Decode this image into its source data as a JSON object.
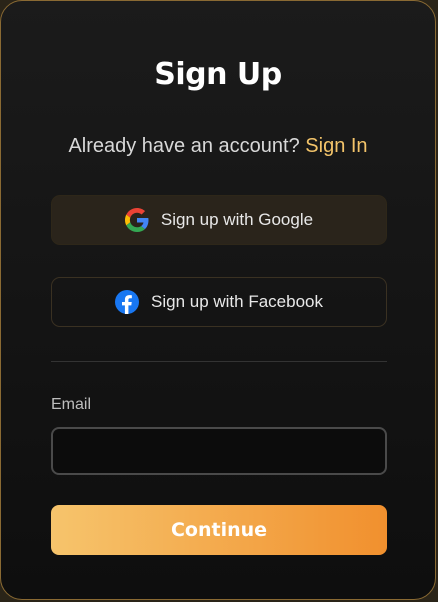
{
  "title": "Sign Up",
  "subtitle": {
    "text": "Already have an account?",
    "link": "Sign In"
  },
  "social": {
    "google_label": "Sign up with Google",
    "google_icon": "google-icon",
    "facebook_label": "Sign up with Facebook",
    "facebook_icon": "facebook-icon"
  },
  "form": {
    "email_label": "Email",
    "email_value": "",
    "continue_label": "Continue"
  },
  "colors": {
    "accent_link": "#f3c46a",
    "button_gradient_start": "#f6c46c",
    "button_gradient_end": "#f1902e",
    "card_border": "#8a6a33"
  }
}
